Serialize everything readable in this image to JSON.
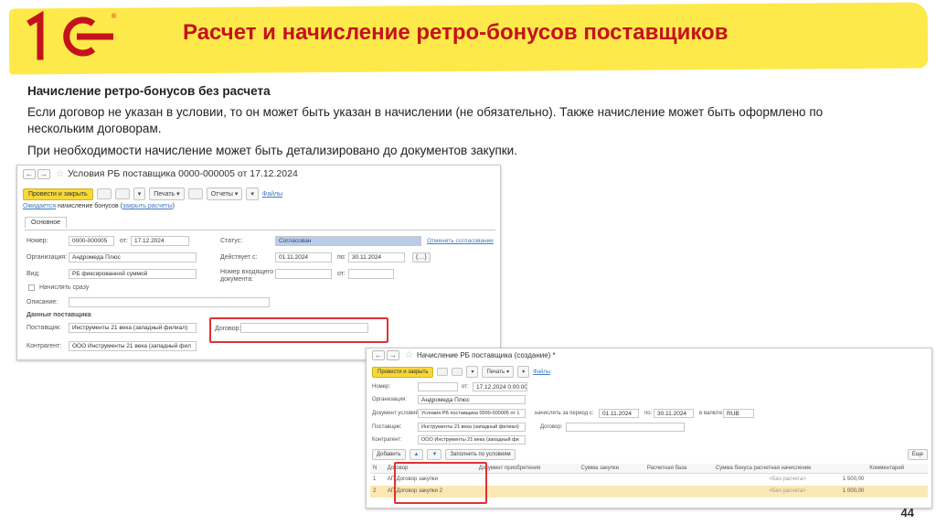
{
  "slide": {
    "title": "Расчет и начисление ретро-бонусов поставщиков",
    "subheading": "Начисление ретро-бонусов без расчета",
    "paragraph1": "Если договор не указан в условии, то он может быть указан в начислении (не обязательно). Также начисление может быть оформлено по нескольким договорам.",
    "paragraph2": "При необходимости начисление может быть детализировано до документов закупки.",
    "page_number": "44",
    "logo_text": "1С"
  },
  "colors": {
    "title": "#c4121c",
    "band": "#fde94a",
    "accent_button": "#f7d839",
    "highlight": "#d33"
  },
  "conditions_window": {
    "title": "Условия РБ поставщика 0000-000005 от 17.12.2024",
    "toolbar": {
      "post_close": "Провести и закрыть",
      "print": "Печать",
      "reports": "Отчеты",
      "files": "Файлы"
    },
    "status_bar": {
      "text": "Ожидается",
      "text2": "начисление бонусов (",
      "link": "закрыть расчеты",
      "text3": ")"
    },
    "tab_main": "Основное",
    "number_label": "Номер:",
    "number_value": "0000-000005",
    "from_label": "от:",
    "date_value": "17.12.2024",
    "status_label": "Статус:",
    "status_value": "Согласован",
    "approval_link": "Отменить согласование",
    "org_label": "Организация:",
    "org_value": "Андромеда Плюс",
    "acts_from_label": "Действует с:",
    "acts_from_value": "01.11.2024",
    "to_label": "по:",
    "acts_to_value": "30.11.2024",
    "period_btn": "(…)",
    "kind_label": "Вид:",
    "kind_value": "РБ фиксированной суммой",
    "incoming_label": "Номер входящего документа:",
    "incoming_from": "от:",
    "accrue_immediately": "Начислять сразу",
    "description_label": "Описание:",
    "supplier_section": "Данные поставщика",
    "supplier_label": "Поставщик:",
    "supplier_value": "Инструменты 21 века (западный филиал)",
    "contract_label": "Договор:",
    "contract_value": "",
    "counterparty_label": "Контрагент:",
    "counterparty_value": "ООО Инструменты 21 века (западный фил"
  },
  "accrual_window": {
    "title": "Начисление РБ поставщика (создание) *",
    "toolbar": {
      "post_close": "Провести и закрыть",
      "print": "Печать",
      "files": "Файлы"
    },
    "number_label": "Номер:",
    "from_label": "от:",
    "date_value": "17.12.2024 0:00:00",
    "org_label": "Организация:",
    "org_value": "Андромеда Плюс",
    "cond_doc_label": "Документ условий:",
    "cond_doc_value": "Условия РБ поставщика 0000-000005 от 1",
    "period_label": "начислить за период с:",
    "period_from": "01.11.2024",
    "period_to_label": "по:",
    "period_to": "30.11.2024",
    "currency_label": "в валюте:",
    "currency_value": "RUB",
    "supplier_label": "Поставщик:",
    "supplier_value": "Инструменты 21 века (западный филиал)",
    "contract_label": "Договор:",
    "counterparty_label": "Контрагент:",
    "counterparty_value": "ООО Инструменты 21 века (западный фи",
    "add_btn": "Добавить",
    "fill_btn": "Заполнить по условиям",
    "more_btn": "Еще",
    "columns": [
      "N",
      "Договор",
      "Документ приобретения",
      "Сумма закупки",
      "Расчетная база",
      "Сумма бонуса расчетная начисление",
      "Комментарий"
    ],
    "rows": [
      {
        "n": "1",
        "contract": "АП Договор закупки",
        "base_hint": "<Без расчета>",
        "amount": "1 500,00"
      },
      {
        "n": "2",
        "contract": "АП Договор закупки 2",
        "base_hint": "<Без расчета>",
        "amount": "1 000,00"
      }
    ]
  }
}
